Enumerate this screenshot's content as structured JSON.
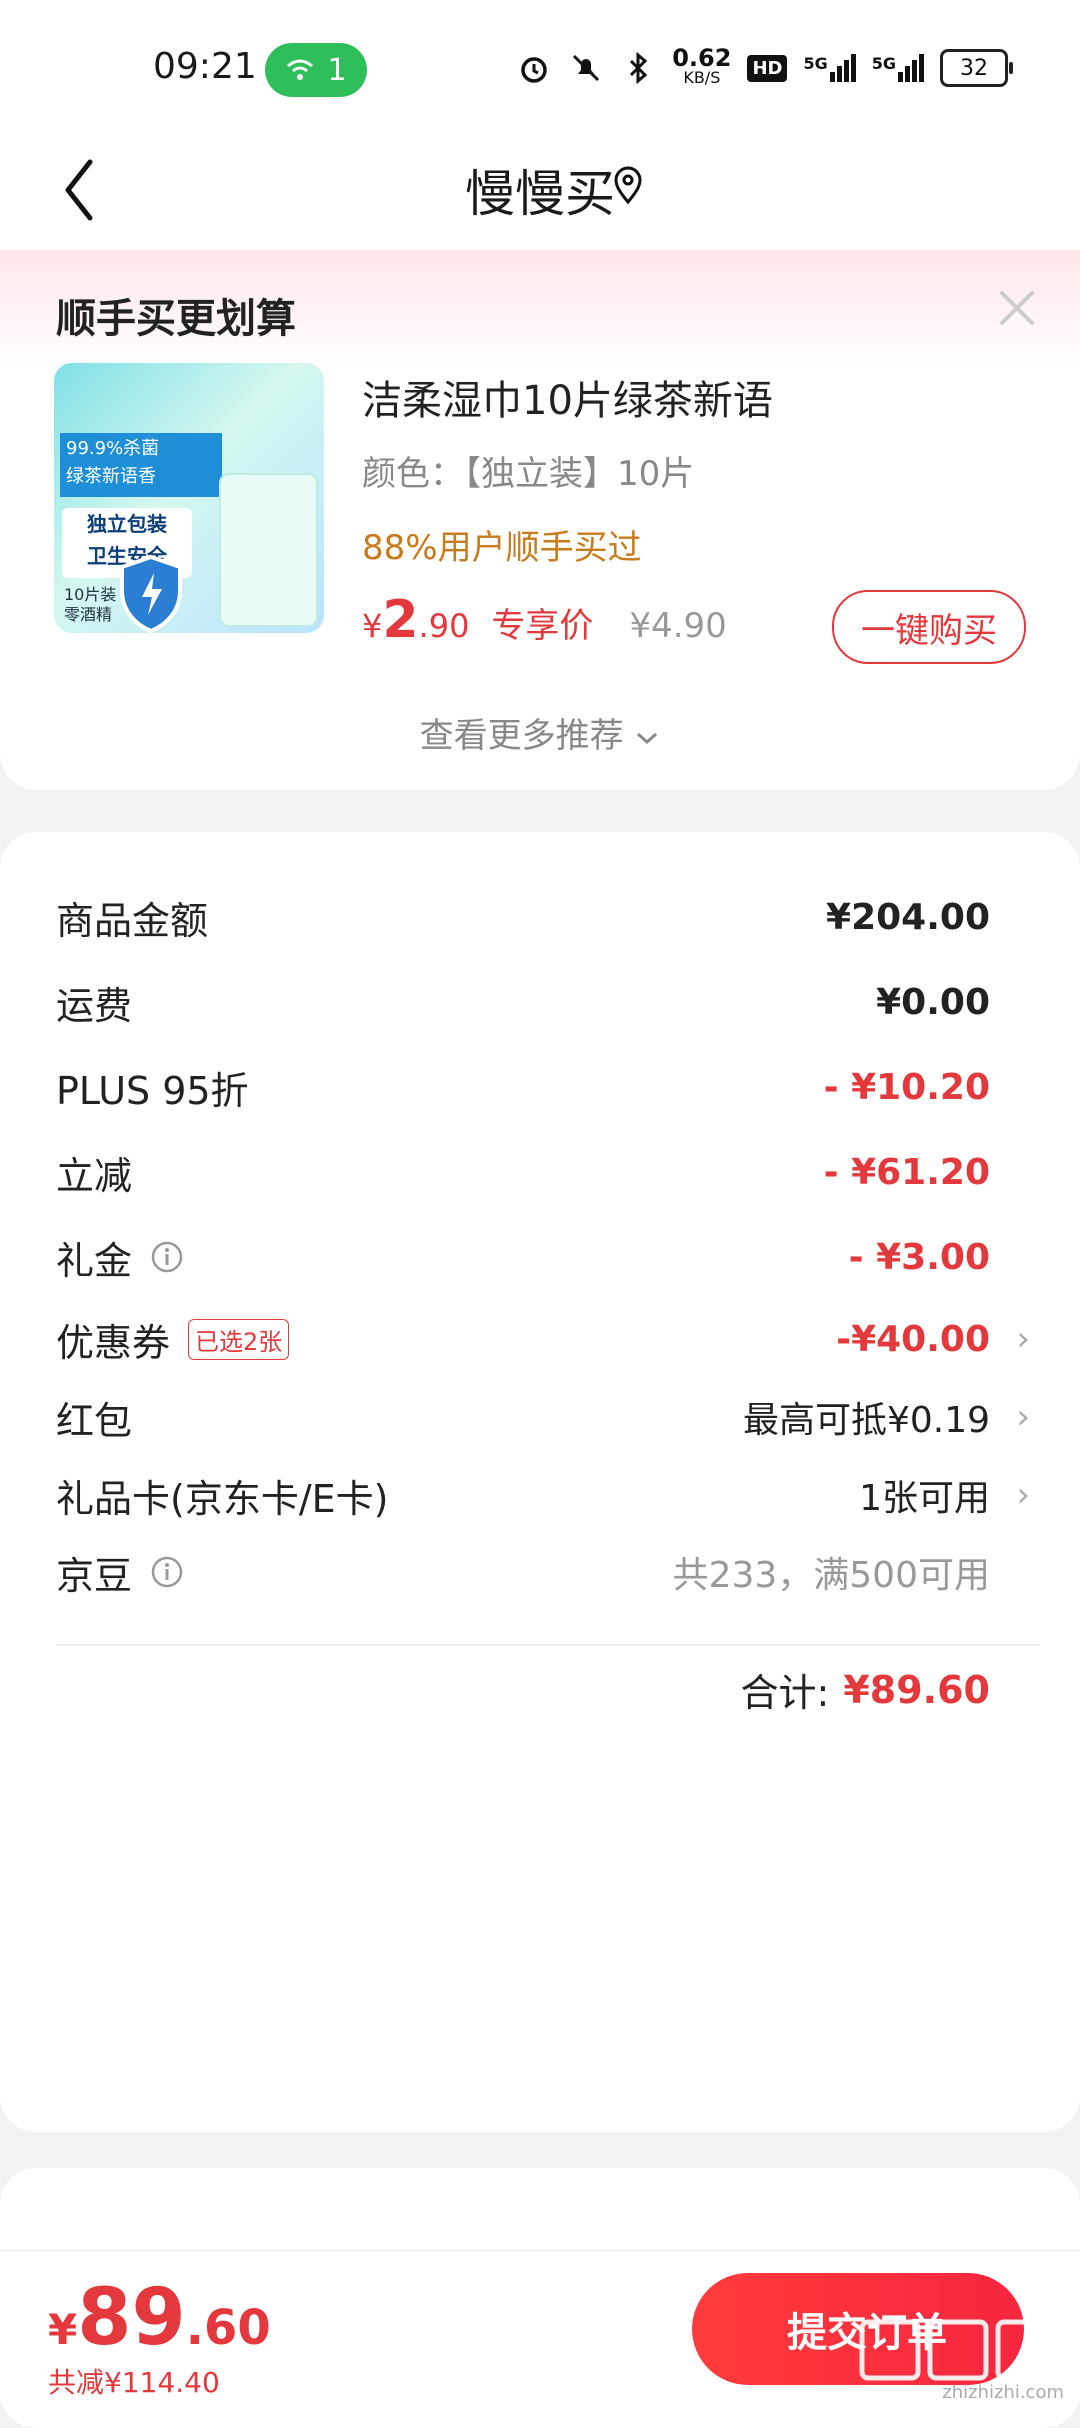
{
  "status_bar": {
    "time": "09:21",
    "wifi_count": "1",
    "net_speed_value": "0.62",
    "net_speed_unit": "KB/S",
    "hd_badge": "HD",
    "sig1_label": "5G",
    "sig2_label": "5G",
    "battery": "32",
    "icons": [
      "alarm-icon",
      "mute-icon",
      "bluetooth-icon",
      "hd-icon",
      "signal-icon",
      "battery-icon"
    ]
  },
  "nav": {
    "title": "慢慢买"
  },
  "recommend": {
    "title": "顺手买更划算",
    "product": {
      "name": "洁柔湿巾10片绿茶新语",
      "spec": "颜色：【独立装】10片",
      "hint": "88%用户顺手买过",
      "price_yen": "¥",
      "price_int": "2",
      "price_dec": ".90",
      "price_tag": "专享价",
      "orig_price": "¥4.90",
      "buy_label": "一键购买",
      "image_text_1": "99.9%杀菌",
      "image_text_2": "绿茶新语香",
      "image_text_3": "独立包装",
      "image_text_4": "卫生安全",
      "image_text_5": "10片装",
      "image_text_6": "零酒精"
    },
    "more": "查看更多推荐"
  },
  "summary": {
    "rows": [
      {
        "label": "商品金额",
        "value": "¥204.00"
      },
      {
        "label": "运费",
        "value": "¥0.00"
      },
      {
        "label": "PLUS 95折",
        "value": "- ¥10.20"
      },
      {
        "label": "立减",
        "value": "- ¥61.20"
      },
      {
        "label": "礼金",
        "value": "- ¥3.00"
      },
      {
        "label": "优惠券",
        "badge": "已选2张",
        "value": "-¥40.00"
      },
      {
        "label": "红包",
        "value": "最高可抵¥0.19"
      },
      {
        "label": "礼品卡(京东卡/E卡)",
        "value": "1张可用"
      },
      {
        "label": "京豆",
        "value": "共233，满500可用"
      }
    ],
    "total_label": "合计:",
    "total_value": "¥89.60"
  },
  "bottom": {
    "yen": "¥",
    "price_int": "89",
    "price_dec": ".60",
    "saved": "共减¥114.40",
    "submit": "提交订单",
    "watermark_sub": "zhizhizhi.com"
  },
  "colors": {
    "accent_red": "#e4393c",
    "wifi_green": "#2fbf5a",
    "hint_orange": "#c97a1a"
  }
}
